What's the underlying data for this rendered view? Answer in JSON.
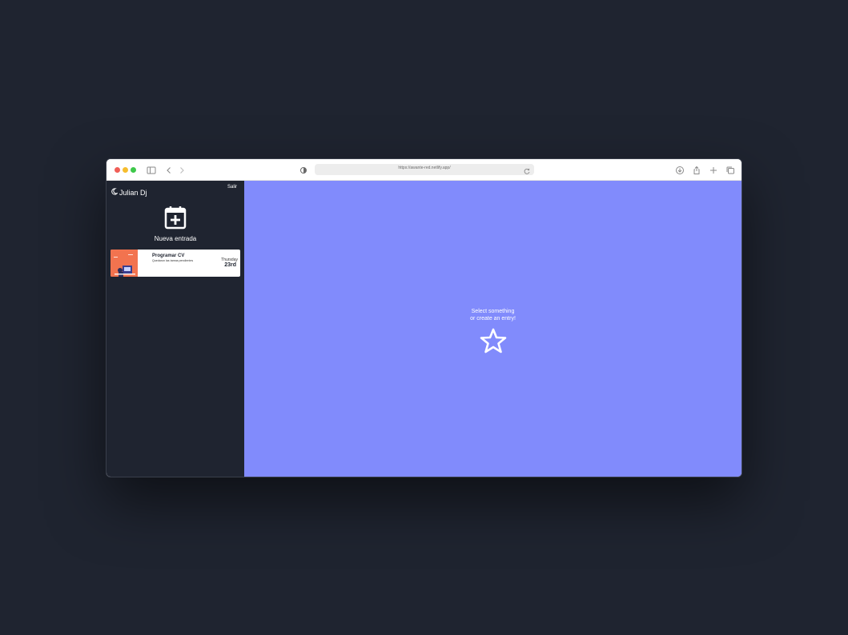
{
  "browser": {
    "url": "https://awante-red.netlify.app/",
    "colors": {
      "traffic_red": "#f05e57",
      "traffic_yellow": "#f6bd2e",
      "traffic_green": "#3ec84a"
    }
  },
  "sidebar": {
    "brand_icon": "moon-icon",
    "brand_name": "Julian Dj",
    "logout_label": "Salir",
    "new_entry": {
      "icon": "calendar-plus-icon",
      "label": "Nueva entrada"
    },
    "entries": [
      {
        "title": "Programar CV",
        "body": "Quedaron las tareas pendientes",
        "weekday": "Thursday",
        "day": "23rd"
      }
    ],
    "background": "#1f2430"
  },
  "main": {
    "background": "#818bfc",
    "message_line1": "Select something",
    "message_line2": "or create an entry!",
    "icon": "star-icon"
  }
}
